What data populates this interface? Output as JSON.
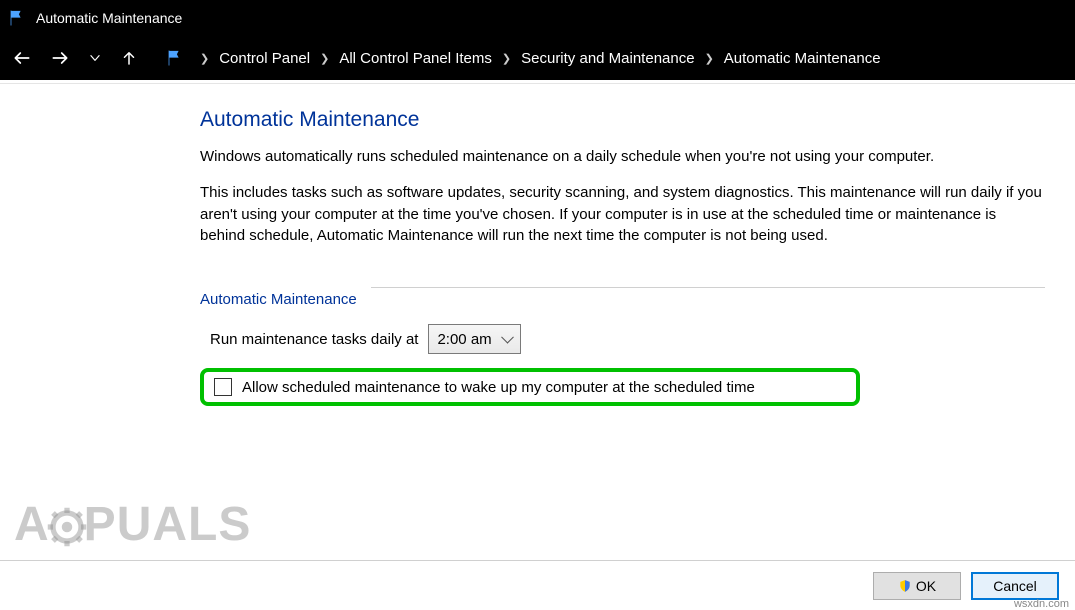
{
  "window": {
    "title": "Automatic Maintenance"
  },
  "breadcrumb": {
    "items": [
      "Control Panel",
      "All Control Panel Items",
      "Security and Maintenance",
      "Automatic Maintenance"
    ]
  },
  "page": {
    "heading": "Automatic Maintenance",
    "para1": "Windows automatically runs scheduled maintenance on a daily schedule when you're not using your computer.",
    "para2": "This includes tasks such as software updates, security scanning, and system diagnostics. This maintenance will run daily if you aren't using your computer at the time you've chosen. If your computer is in use at the scheduled time or maintenance is behind schedule, Automatic Maintenance will run the next time the computer is not being used.",
    "section_label": "Automatic Maintenance",
    "run_label": "Run maintenance tasks daily at",
    "time_value": "2:00 am",
    "checkbox_label": "Allow scheduled maintenance to wake up my computer at the scheduled time"
  },
  "buttons": {
    "ok": "OK",
    "cancel": "Cancel"
  },
  "watermark": {
    "text_left": "A",
    "text_right": "PUALS"
  },
  "attribution": "wsxdn.com"
}
